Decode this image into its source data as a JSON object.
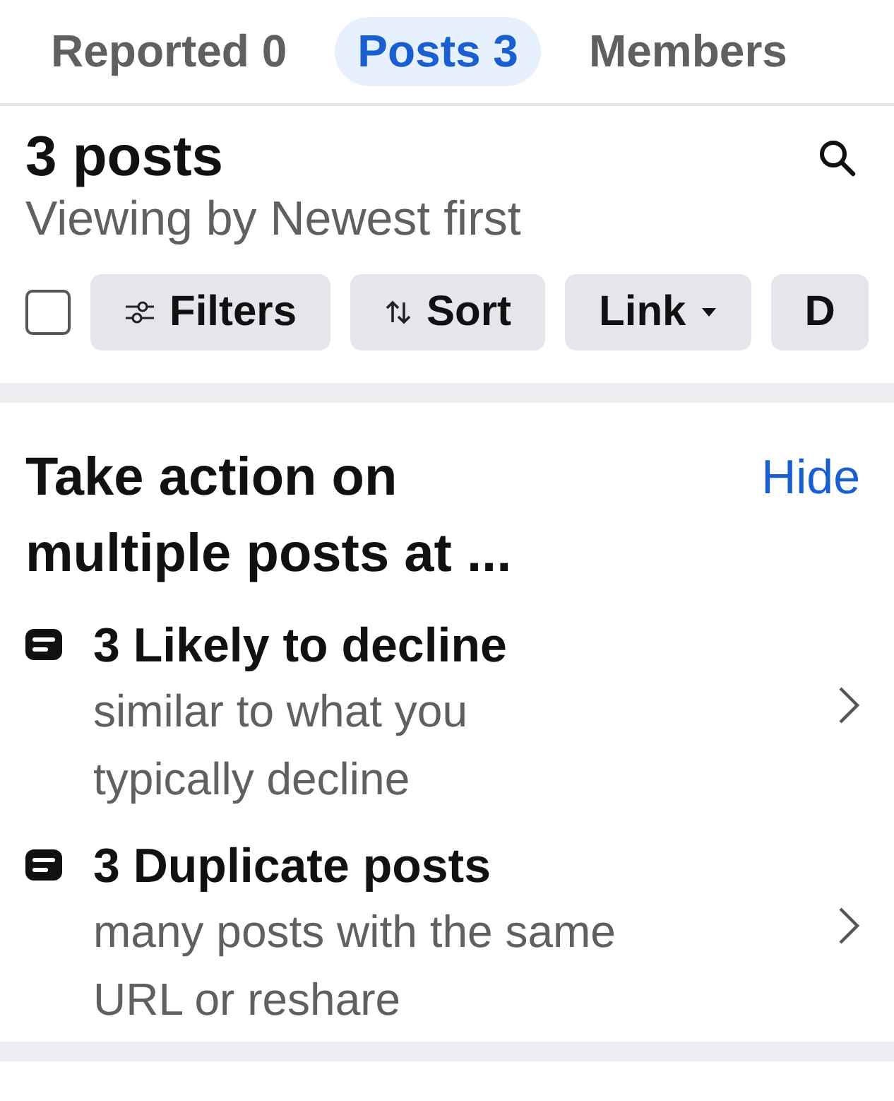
{
  "tabs": [
    {
      "label": "Reported 0",
      "selected": false
    },
    {
      "label": "Posts 3",
      "selected": true
    },
    {
      "label": "Members",
      "selected": false
    }
  ],
  "header": {
    "title": "3 posts",
    "subtitle": "Viewing by Newest first"
  },
  "toolbar": {
    "select_all": {
      "checked": false
    },
    "chips": [
      {
        "kind": "filters",
        "label": "Filters"
      },
      {
        "kind": "sort",
        "label": "Sort"
      },
      {
        "kind": "dropdown",
        "label": "Link"
      },
      {
        "kind": "plain",
        "label": "D"
      }
    ]
  },
  "bulk_actions": {
    "title": "Take action on multiple posts at ...",
    "hide_link": "Hide",
    "items": [
      {
        "title": "3 Likely to decline",
        "description": "similar to what you typically decline"
      },
      {
        "title": "3 Duplicate posts",
        "description": "many posts with the same URL or reshare"
      }
    ]
  }
}
